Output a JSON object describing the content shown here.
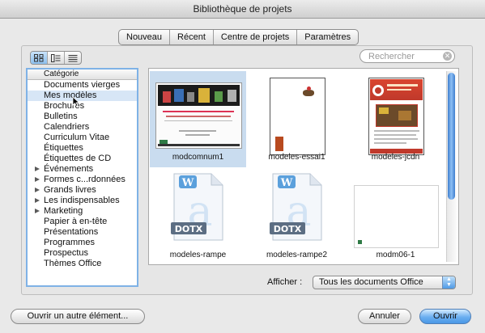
{
  "window": {
    "title": "Bibliothèque de projets"
  },
  "tabs": [
    {
      "label": "Nouveau",
      "active": true
    },
    {
      "label": "Récent",
      "active": false
    },
    {
      "label": "Centre de projets",
      "active": false
    },
    {
      "label": "Paramètres",
      "active": false
    }
  ],
  "view_modes": [
    "icon-view-icon",
    "list-detail-view-icon",
    "list-view-icon"
  ],
  "search": {
    "placeholder": "Rechercher",
    "value": ""
  },
  "categories": {
    "header": "Catégorie",
    "items": [
      {
        "label": "Documents vierges",
        "expandable": false,
        "selected": false
      },
      {
        "label": "Mes modèles",
        "expandable": false,
        "selected": true
      },
      {
        "label": "Brochures",
        "expandable": false,
        "selected": false
      },
      {
        "label": "Bulletins",
        "expandable": false,
        "selected": false
      },
      {
        "label": "Calendriers",
        "expandable": false,
        "selected": false
      },
      {
        "label": "Curriculum Vitae",
        "expandable": false,
        "selected": false
      },
      {
        "label": "Étiquettes",
        "expandable": false,
        "selected": false
      },
      {
        "label": "Étiquettes de CD",
        "expandable": false,
        "selected": false
      },
      {
        "label": "Événements",
        "expandable": true,
        "selected": false
      },
      {
        "label": "Formes c...rdonnées",
        "expandable": true,
        "selected": false
      },
      {
        "label": "Grands livres",
        "expandable": true,
        "selected": false
      },
      {
        "label": "Les indispensables",
        "expandable": true,
        "selected": false
      },
      {
        "label": "Marketing",
        "expandable": true,
        "selected": false
      },
      {
        "label": "Papier à en-tête",
        "expandable": false,
        "selected": false
      },
      {
        "label": "Présentations",
        "expandable": false,
        "selected": false
      },
      {
        "label": "Programmes",
        "expandable": false,
        "selected": false
      },
      {
        "label": "Prospectus",
        "expandable": false,
        "selected": false
      },
      {
        "label": "Thèmes Office",
        "expandable": false,
        "selected": false
      }
    ]
  },
  "templates": [
    {
      "name": "modcomnum1",
      "kind": "presentation",
      "selected": true
    },
    {
      "name": "modeles-essai1",
      "kind": "page-essai",
      "selected": false
    },
    {
      "name": "modeles-jcdn",
      "kind": "page-jcdn",
      "selected": false
    },
    {
      "name": "modeles-rampe",
      "kind": "dotx",
      "selected": false
    },
    {
      "name": "modeles-rampe2",
      "kind": "dotx",
      "selected": false
    },
    {
      "name": "modm06-1",
      "kind": "blank-landscape",
      "selected": false
    }
  ],
  "dotx_label": "DOTX",
  "filter": {
    "label": "Afficher :",
    "value": "Tous les documents Office"
  },
  "buttons": {
    "open_other": "Ouvrir un autre élément...",
    "cancel": "Annuler",
    "open": "Ouvrir"
  },
  "colors": {
    "accent": "#5aa3ec",
    "selection": "#c9dcef",
    "jcdn_header": "#c0392b"
  }
}
